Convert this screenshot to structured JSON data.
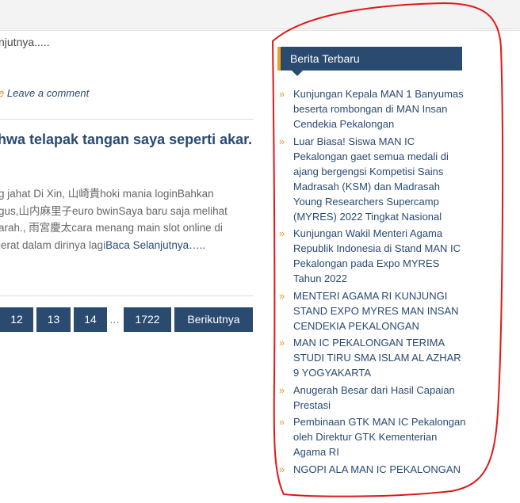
{
  "main": {
    "read_more_top": "njutnya.....",
    "meta": {
      "leave_comment": "Leave a comment"
    },
    "post_title": "hwa telapak tangan saya seperti akar.",
    "excerpt": {
      "line1": "g jahat Di Xin, 山崎貴hoki mania loginBahkan",
      "line2": "gus,山内麻里子euro bwinSaya baru saja melihat",
      "line3": "arah., 雨宮慶太cara menang main slot online di",
      "line4_prefix": "jerat dalam dirinya lagi",
      "read_more": "Baca Selanjutnya….."
    }
  },
  "pagination": {
    "pages": [
      "12",
      "13",
      "14"
    ],
    "ellipsis": "…",
    "last": "1722",
    "next": "Berikutnya"
  },
  "sidebar": {
    "widget_title": "Berita Terbaru",
    "bullet": "»",
    "items": [
      "Kunjungan Kepala MAN 1 Banyumas beserta rombongan di MAN Insan Cendekia Pekalongan",
      "Luar Biasa! Siswa MAN IC Pekalongan gaet semua medali di ajang bergengsi Kompetisi Sains Madrasah (KSM) dan Madrasah Young Researchers Supercamp (MYRES) 2022 Tingkat Nasional",
      "Kunjungan Wakil Menteri Agama Republik Indonesia di Stand MAN IC Pekalongan pada Expo MYRES Tahun 2022",
      "MENTERI AGAMA RI KUNJUNGI STAND EXPO MYRES MAN INSAN CENDEKIA PEKALONGAN",
      "MAN IC PEKALONGAN TERIMA STUDI TIRU SMA ISLAM AL AZHAR 9 YOGYAKARTA",
      "Anugerah Besar dari Hasil Capaian Prestasi",
      "Pembinaan GTK MAN IC Pekalongan oleh Direktur GTK Kementerian Agama RI",
      "NGOPI ALA MAN IC PEKALONGAN"
    ]
  },
  "colors": {
    "accent_navy": "#2b4a70",
    "accent_orange": "#f0a020",
    "annotation_red": "#e01818"
  }
}
